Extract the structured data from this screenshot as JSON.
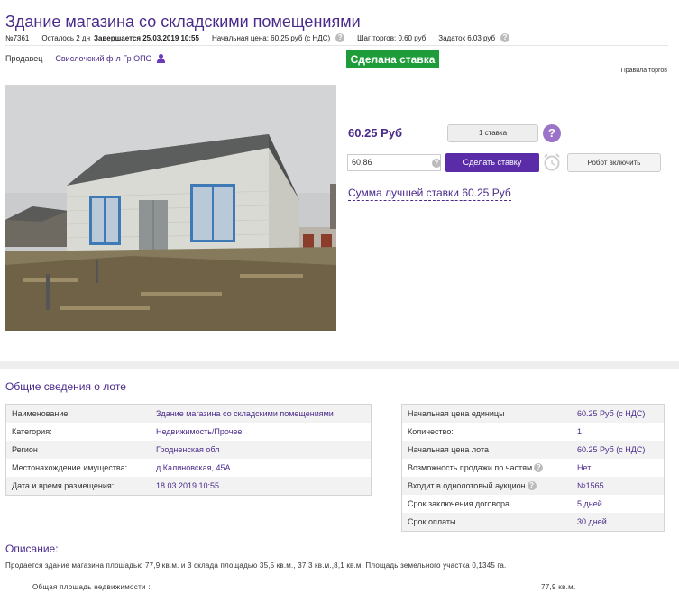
{
  "lot": {
    "title": "Здание магазина со складскими помещениями",
    "number": "№7361",
    "time_left": "Осталось 2 дн",
    "ends": "Завершается 25.03.2019 10:55",
    "start_price": "Начальная цена: 60.25 руб (с НДС)",
    "bid_step": "Шаг торгов: 0.60 руб",
    "deposit": "Задаток 6.03 руб"
  },
  "seller": {
    "label": "Продавец",
    "name": "Свислочский ф-л Гр ОПО"
  },
  "status_badge": "Сделана ставка",
  "rules_link": "Правила торгов",
  "bidding": {
    "current_price": "60.25 Руб",
    "bids_count_label": "1 ставка",
    "bid_input_value": "60.86",
    "make_bid_label": "Сделать ставку",
    "robot_label": "Робот включить",
    "best_bid_text": "Сумма лучшей ставки 60.25 Руб"
  },
  "general": {
    "title": "Общие сведения о лоте",
    "left_rows": [
      {
        "key": "Наименование:",
        "value": "Здание магазина со складскими помещениями"
      },
      {
        "key": "Категория:",
        "value": "Недвижимость/Прочее"
      },
      {
        "key": "Регион",
        "value": "Гродненская обл"
      },
      {
        "key": "Местонахождение имущества:",
        "value": "д.Калиновская, 45А"
      },
      {
        "key": "Дата и время размещения:",
        "value": "18.03.2019 10:55"
      }
    ],
    "right_rows": [
      {
        "key": "Начальная цена единицы",
        "value": "60.25 Руб (с НДС)"
      },
      {
        "key": "Количество:",
        "value": "1"
      },
      {
        "key": "Начальная цена лота",
        "value": "60.25 Руб (с НДС)"
      },
      {
        "key": "Возможность продажи по частям",
        "value": "Нет"
      },
      {
        "key": "Входит в однолотовый аукцион",
        "value": "№1565"
      },
      {
        "key": "Срок заключения договора",
        "value": "5 дней"
      },
      {
        "key": "Срок оплаты",
        "value": "30 дней"
      }
    ]
  },
  "description": {
    "title": "Описание:",
    "text": "Продается здание магазина площадью 77,9 кв.м. и 3 склада площадью 35,5 кв.м., 37,3 кв.м.,8,1 кв.м. Площадь земельного участка 0,1345 га.",
    "area_label": "Общая площадь недвижимости :",
    "area_value": "77,9 кв.м."
  },
  "colors": {
    "accent": "#4a2a8a",
    "button": "#5b2ca8",
    "badge": "#1f9c3a"
  }
}
